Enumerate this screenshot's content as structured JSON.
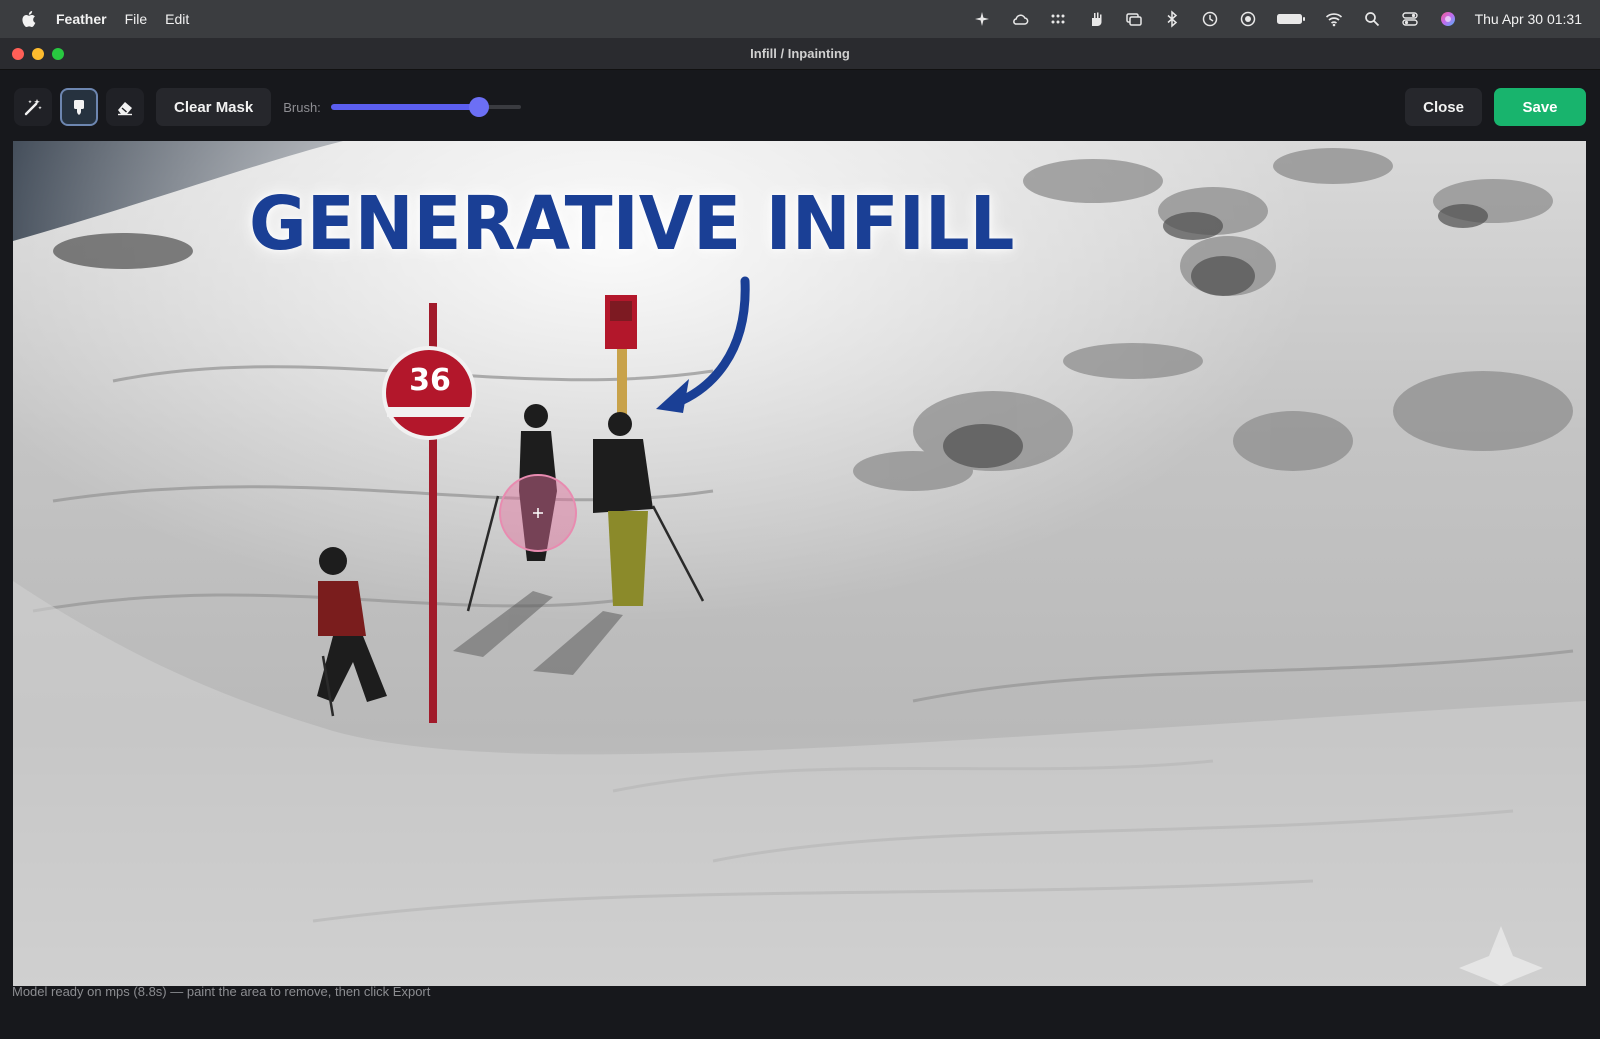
{
  "menubar": {
    "app_name": "Feather",
    "menus": [
      "File",
      "Edit"
    ],
    "status_icons": [
      "ai-sparkle-icon",
      "cloud-sync-icon",
      "grid-dots-icon",
      "hand-icon",
      "screen-mirror-icon",
      "bluetooth-icon",
      "time-machine-icon",
      "record-icon",
      "battery-icon",
      "wifi-icon",
      "spotlight-search-icon",
      "control-center-icon",
      "siri-icon"
    ],
    "clock": "Thu Apr 30  01:31"
  },
  "window": {
    "title": "Infill / Inpainting"
  },
  "toolbar": {
    "tools": [
      {
        "name": "magic-wand-tool",
        "icon": "magic-wand-icon",
        "active": false
      },
      {
        "name": "brush-tool",
        "icon": "brush-icon",
        "active": true
      },
      {
        "name": "eraser-tool",
        "icon": "eraser-icon",
        "active": false
      }
    ],
    "clear_mask_label": "Clear Mask",
    "brush_label": "Brush:",
    "brush_level": 0.78,
    "close_label": "Close",
    "save_label": "Save",
    "accent_color": "#5b5ef0",
    "save_color": "#18b46d"
  },
  "canvas": {
    "headline": "GENERATIVE INFILL",
    "headline_color": "#1a3f95",
    "sign_number": "36"
  },
  "status": {
    "message": "Model ready on mps (8.8s) — paint the area to remove, then click  Export"
  }
}
